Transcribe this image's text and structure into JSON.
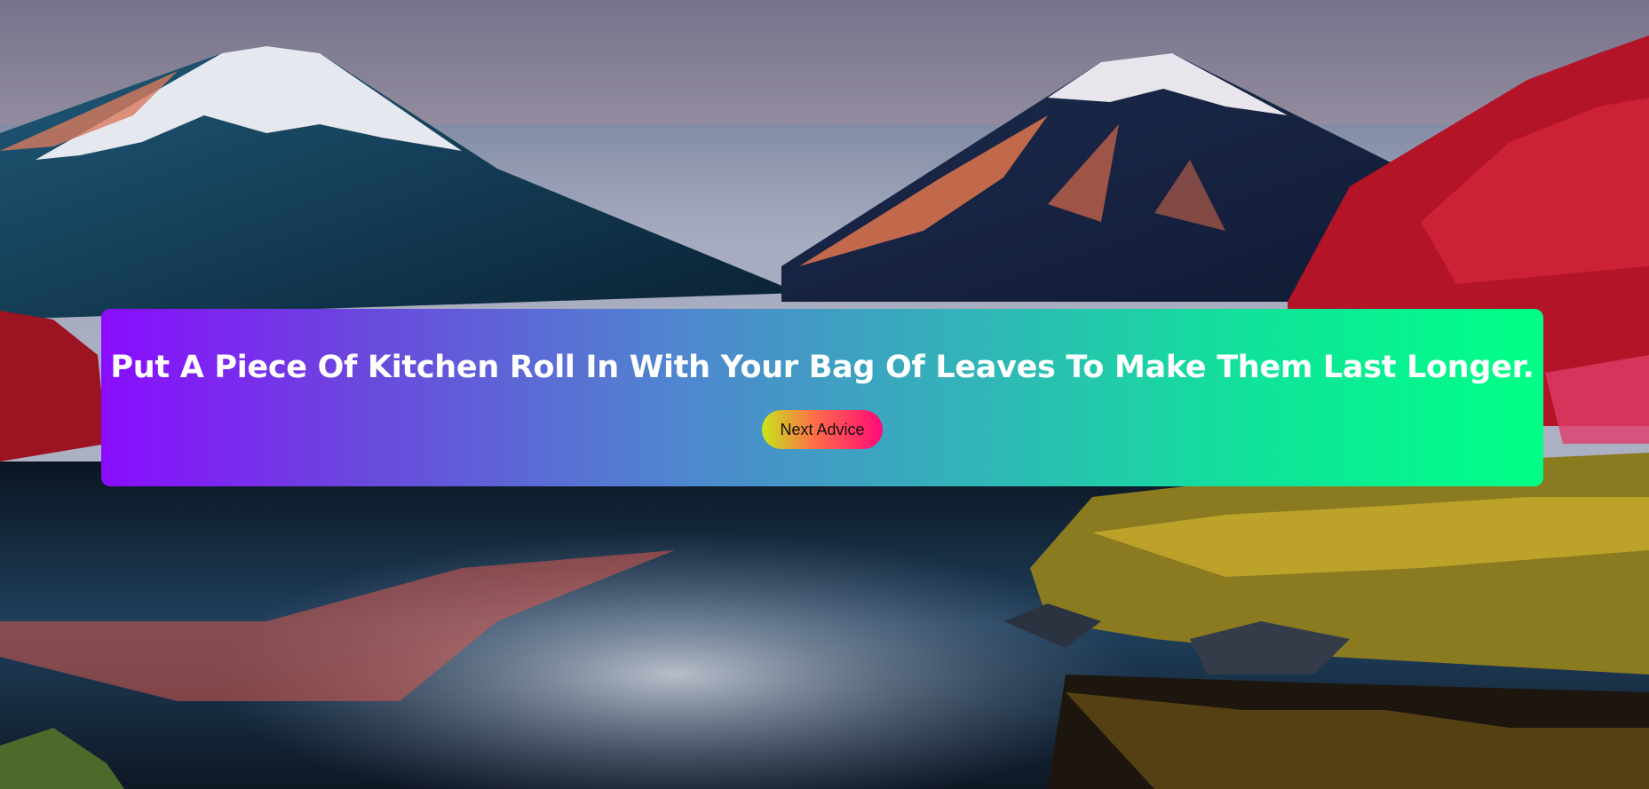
{
  "advice": {
    "text": "Put A Piece Of Kitchen Roll In With Your Bag Of Leaves To Make Them Last Longer."
  },
  "controls": {
    "next_label": "Next Advice"
  },
  "colors": {
    "card_gradient_start": "#8a0cff",
    "card_gradient_end": "#00ff86",
    "button_gradient_start": "#c7e51a",
    "button_gradient_end": "#ff0a78",
    "advice_text": "#ffffff"
  }
}
